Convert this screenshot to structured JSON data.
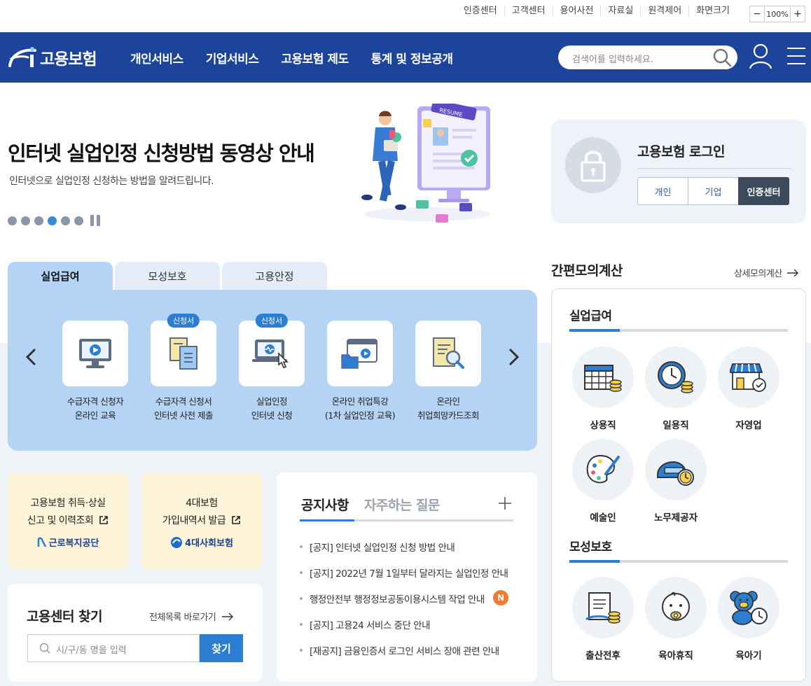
{
  "util": {
    "links": [
      "인증센터",
      "고객센터",
      "용어사전",
      "자료실",
      "원격제어",
      "화면크기"
    ],
    "zoom_minus": "−",
    "zoom_value": "100%",
    "zoom_plus": "+"
  },
  "header": {
    "logo": "고용보험",
    "nav": [
      "개인서비스",
      "기업서비스",
      "고용보험 제도",
      "통계 및 정보공개"
    ],
    "search_placeholder": "검색어를 입력하세요."
  },
  "hero": {
    "title": "인터넷 실업인정 신청방법 동영상 안내",
    "subtitle": "인터넷으로 실업인정 신청하는 방법을 알려드립니다.",
    "illust_label": "RESUME",
    "slide_count": 6,
    "active_slide": 4
  },
  "login": {
    "title": "고용보험 로그인",
    "tabs": [
      "개인",
      "기업",
      "인증센터"
    ]
  },
  "services": {
    "tabs": [
      "실업급여",
      "모성보호",
      "고용안정"
    ],
    "items": [
      {
        "badge": "",
        "line1": "수급자격 신청자",
        "line2": "온라인 교육"
      },
      {
        "badge": "신청서",
        "line1": "수급자격 신청서",
        "line2": "인터넷 사전 제출"
      },
      {
        "badge": "신청서",
        "line1": "실업인정",
        "line2": "인터넷 신청"
      },
      {
        "badge": "",
        "line1": "온라인 취업특강",
        "line2": "(1차 실업인정 교육)"
      },
      {
        "badge": "",
        "line1": "온라인",
        "line2": "취업희망카드조회"
      }
    ]
  },
  "cards": [
    {
      "line1": "고용보험 취득·상실",
      "line2": "신고 및 이력조회",
      "org": "근로복지공단"
    },
    {
      "line1": "4대보험",
      "line2": "가입내역서 발급",
      "org": "4대사회보험"
    }
  ],
  "finder": {
    "title": "고용센터 찾기",
    "link": "전체목록 바로가기",
    "placeholder": "시/구/동 명을 입력",
    "button": "찾기"
  },
  "notice": {
    "tabs": [
      "공지사항",
      "자주하는 질문"
    ],
    "new_badge": "N",
    "items": [
      "[공지] 인터넷 실업인정 신청 방법 안내",
      "[공지] 2022년 7월 1일부터 달라지는 실업인정 안내",
      "행정안전부 행정정보공동이용시스템 작업 안내",
      "[공지] 고용24 서비스 중단 안내",
      "[재공지] 금융인증서 로그인 서비스 장애 관련 안내"
    ]
  },
  "calc": {
    "title": "간편모의계산",
    "link": "상세모의계산",
    "section1": "실업급여",
    "items1": [
      "상용직",
      "일용직",
      "자영업",
      "예술인",
      "노무제공자"
    ],
    "section2": "모성보호",
    "items2": [
      "출산전후",
      "육아휴직",
      "육아기"
    ]
  },
  "colors": {
    "header_bg": "#1d449b",
    "accent": "#2b7ed1",
    "panel": "#b4d3f5",
    "card_yellow": "#fdf3d8",
    "new_badge": "#f07a32"
  }
}
